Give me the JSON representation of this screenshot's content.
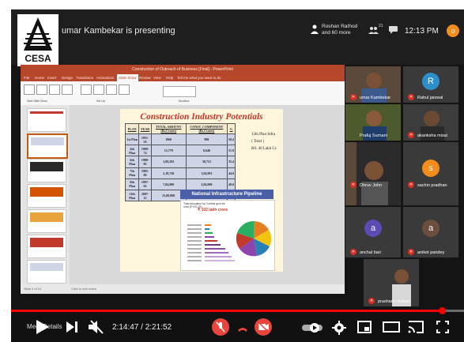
{
  "meeting": {
    "presenting_text": "umar Kambekar is presenting",
    "participants_btn": "Roshan Rathod and 60 more",
    "participants_count": "21",
    "time": "12:13 PM",
    "user_initial": "o"
  },
  "ppt": {
    "window_title": "Construction of Outreach of Business [Final] - PowerPoint",
    "tabs": [
      "File",
      "Home",
      "Insert",
      "Design",
      "Transitions",
      "Animations",
      "Slide Show",
      "Review",
      "View",
      "Help",
      "Tell me what you want to do"
    ],
    "ribbon_groups": [
      "Start Slide Show",
      "Set Up",
      "Monitors"
    ],
    "status_left": "Slide 3 of 24",
    "notes_placeholder": "Click to add notes"
  },
  "slide": {
    "title": "Construction Industry Potentials",
    "table": {
      "headers": [
        "PLAN",
        "YEAR",
        "TOTAL AMOUNT (Rs.Crores)",
        "CONST. COMPONENT (Rs.Crores)",
        "%"
      ],
      "rows": [
        [
          "1st Plan",
          "1951-56",
          "1960",
          "980",
          "50.4"
        ],
        [
          "4th Plan",
          "1969-74",
          "15,779",
          "8,640",
          "51.8"
        ],
        [
          "6th Plan",
          "1980-85",
          "1,09,292",
          "38,712",
          "35.4"
        ],
        [
          "7th Plan",
          "1985-90",
          "2,18,730",
          "1,04,991",
          "44.0"
        ],
        [
          "9th Plan",
          "1997-02",
          "7,84,000",
          "3,84,000",
          "49.0"
        ],
        [
          "11th Plan",
          "2007-12",
          "25,00,000",
          "10,00,000",
          "40.0"
        ]
      ]
    },
    "note_lines": [
      "12th Plan Infra",
      "( Total )",
      "RS.  40 Lakh Cr."
    ],
    "nip_banner": "National Infrastructure Pipeline",
    "nip_total_label": "Total allocation by Central govt for infra (FY20-25)",
    "nip_value": "₹ 102 lakh crore"
  },
  "participants": [
    {
      "name": "umar Kambekar",
      "type": "video"
    },
    {
      "name": "Rahul jaiswal",
      "type": "avatar",
      "initial": "R",
      "color": "#2d8fc9"
    },
    {
      "name": "Prafuj Surnani",
      "type": "video"
    },
    {
      "name": "akanksha misal",
      "type": "video"
    },
    {
      "name": "Dhruv John",
      "type": "video"
    },
    {
      "name": "sachin pradhan",
      "type": "avatar",
      "initial": "s",
      "color": "#f28c1c"
    },
    {
      "name": "anchal bari",
      "type": "avatar",
      "initial": "a",
      "color": "#5b4bb2"
    },
    {
      "name": "aniket pandey",
      "type": "avatar",
      "initial": "a",
      "color": "#6b4e3d"
    },
    {
      "name": "prashant chavan",
      "type": "video"
    }
  ],
  "player": {
    "time_text": "2:14:47 / 2:21:52",
    "progress": 0.951,
    "title_overlay": "Meet Details"
  }
}
